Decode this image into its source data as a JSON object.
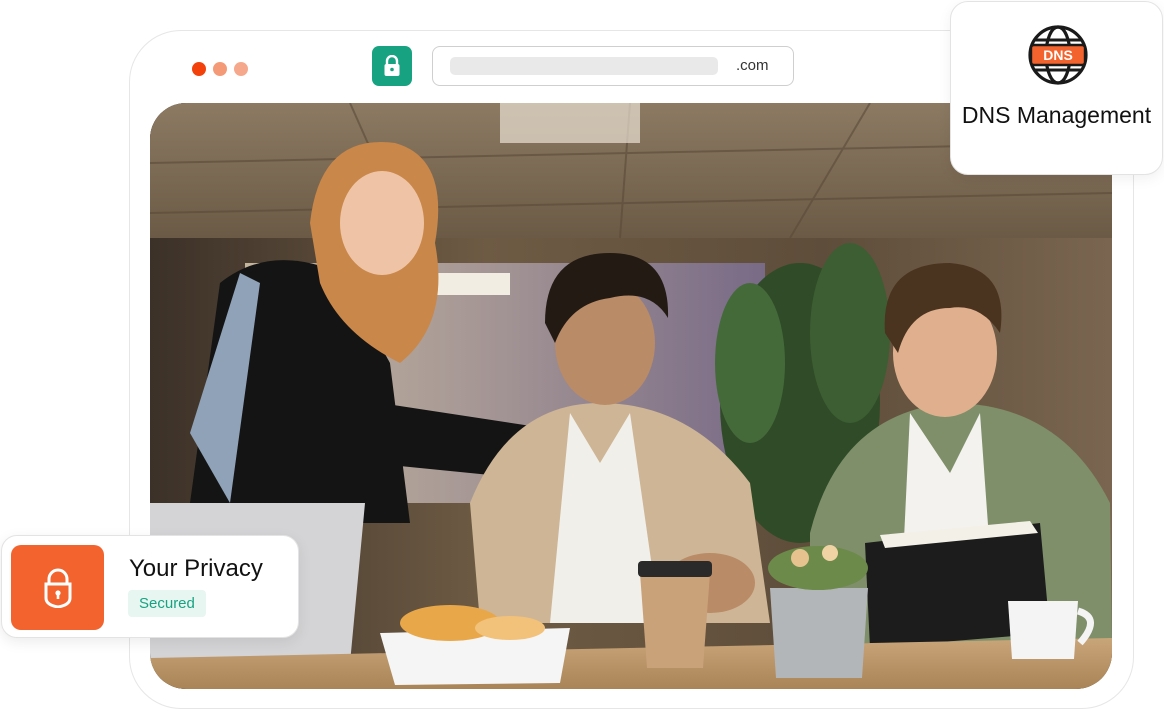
{
  "browser": {
    "window_dots": [
      "#f3410c",
      "#f59a77",
      "#f6a88c"
    ],
    "lock_icon": "padlock-icon",
    "address": {
      "tld": ".com"
    }
  },
  "photo": {
    "subject": "office-meeting-photo"
  },
  "dns_card": {
    "icon": "globe-dns-icon",
    "icon_text": "DNS",
    "label": "DNS Management",
    "accent": "#f3632d"
  },
  "privacy_card": {
    "icon": "padlock-icon",
    "title": "Your Privacy",
    "status": "Secured",
    "accent": "#f3632d",
    "status_color": "#17a382"
  }
}
